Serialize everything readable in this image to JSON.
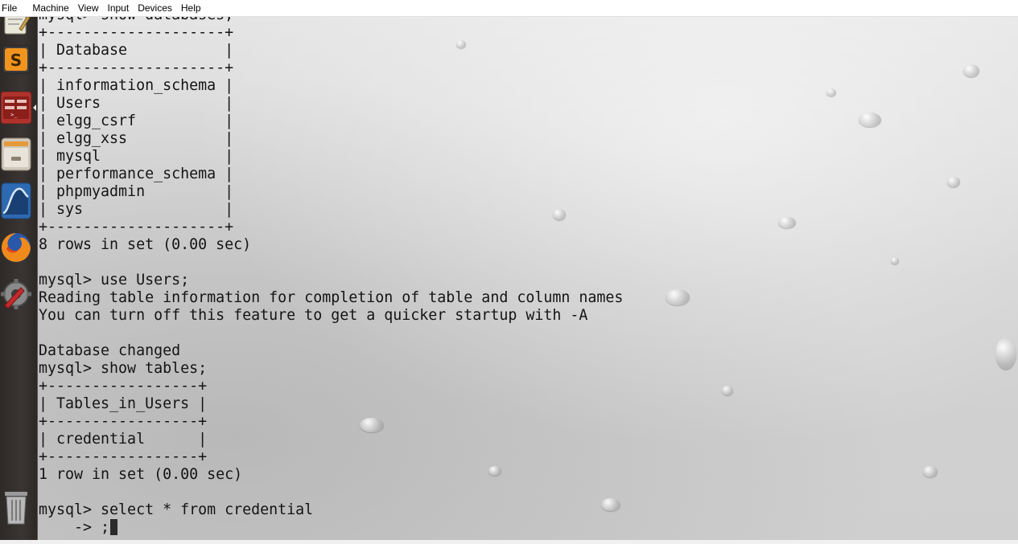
{
  "menubar": {
    "items": [
      "File",
      "Machine",
      "View",
      "Input",
      "Devices",
      "Help"
    ]
  },
  "launcher": {
    "icons": [
      "text-editor-icon",
      "sublime-text-icon",
      "terminal-icon",
      "file-manager-icon",
      "wireshark-icon",
      "firefox-icon",
      "system-settings-icon",
      "trash-icon"
    ]
  },
  "terminal": {
    "lines": [
      "mysql> show databases;",
      "+--------------------+",
      "| Database           |",
      "+--------------------+",
      "| information_schema |",
      "| Users              |",
      "| elgg_csrf          |",
      "| elgg_xss           |",
      "| mysql              |",
      "| performance_schema |",
      "| phpmyadmin         |",
      "| sys                |",
      "+--------------------+",
      "8 rows in set (0.00 sec)",
      "",
      "mysql> use Users;",
      "Reading table information for completion of table and column names",
      "You can turn off this feature to get a quicker startup with -A",
      "",
      "Database changed",
      "mysql> show tables;",
      "+-----------------+",
      "| Tables_in_Users |",
      "+-----------------+",
      "| credential      |",
      "+-----------------+",
      "1 row in set (0.00 sec)",
      "",
      "mysql> select * from credential"
    ],
    "current_input": "    -> ;"
  },
  "colors": {
    "text": "#141414",
    "launcher_bg": "#2e2a28",
    "menubar_bg": "#ffffff"
  }
}
